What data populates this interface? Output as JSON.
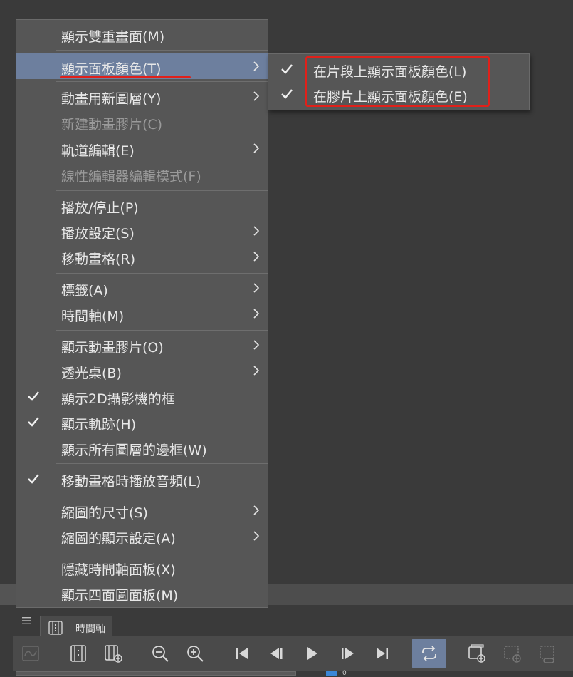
{
  "main_menu": {
    "items": [
      {
        "label": "顯示雙重畫面(M)",
        "checked": false,
        "submenu": false,
        "disabled": false
      },
      {
        "label": "顯示面板顏色(T)",
        "checked": false,
        "submenu": true,
        "disabled": false,
        "selected": true
      },
      {
        "label": "動畫用新圖層(Y)",
        "checked": false,
        "submenu": true,
        "disabled": false
      },
      {
        "label": "新建動畫膠片(C)",
        "checked": false,
        "submenu": false,
        "disabled": true
      },
      {
        "label": "軌道編輯(E)",
        "checked": false,
        "submenu": true,
        "disabled": false
      },
      {
        "label": "線性編輯器編輯模式(F)",
        "checked": false,
        "submenu": false,
        "disabled": true
      },
      {
        "label": "播放/停止(P)",
        "checked": false,
        "submenu": false,
        "disabled": false
      },
      {
        "label": "播放設定(S)",
        "checked": false,
        "submenu": true,
        "disabled": false
      },
      {
        "label": "移動畫格(R)",
        "checked": false,
        "submenu": true,
        "disabled": false
      },
      {
        "label": "標籤(A)",
        "checked": false,
        "submenu": true,
        "disabled": false
      },
      {
        "label": "時間軸(M)",
        "checked": false,
        "submenu": true,
        "disabled": false
      },
      {
        "label": "顯示動畫膠片(O)",
        "checked": false,
        "submenu": true,
        "disabled": false
      },
      {
        "label": "透光桌(B)",
        "checked": false,
        "submenu": true,
        "disabled": false
      },
      {
        "label": "顯示2D攝影機的框",
        "checked": true,
        "submenu": false,
        "disabled": false
      },
      {
        "label": "顯示軌跡(H)",
        "checked": true,
        "submenu": false,
        "disabled": false
      },
      {
        "label": "顯示所有圖層的邊框(W)",
        "checked": false,
        "submenu": false,
        "disabled": false
      },
      {
        "label": "移動畫格時播放音頻(L)",
        "checked": true,
        "submenu": false,
        "disabled": false
      },
      {
        "label": "縮圖的尺寸(S)",
        "checked": false,
        "submenu": true,
        "disabled": false
      },
      {
        "label": "縮圖的顯示設定(A)",
        "checked": false,
        "submenu": true,
        "disabled": false
      },
      {
        "label": "隱藏時間軸面板(X)",
        "checked": false,
        "submenu": false,
        "disabled": false
      },
      {
        "label": "顯示四面圖面板(M)",
        "checked": false,
        "submenu": false,
        "disabled": false
      }
    ]
  },
  "submenu": {
    "items": [
      {
        "label": "在片段上顯示面板顏色(L)",
        "checked": true
      },
      {
        "label": "在膠片上顯示面板顏色(E)",
        "checked": true
      }
    ]
  },
  "panel": {
    "tab_label": "時間軸",
    "row_number": "0"
  },
  "toolbar": {
    "icons": [
      "waveform-icon",
      "frame-icon",
      "add-frame-icon",
      "zoom-out-icon",
      "zoom-in-icon",
      "first-frame-icon",
      "prev-frame-icon",
      "play-icon",
      "next-frame-icon",
      "last-frame-icon",
      "loop-icon",
      "new-cel-icon",
      "add-clip-icon",
      "link-clip-icon"
    ]
  },
  "colors": {
    "menu_bg": "#565656",
    "highlight": "#6d7f9e",
    "annotation_red": "#e0201a",
    "background": "#3a3a3a"
  }
}
